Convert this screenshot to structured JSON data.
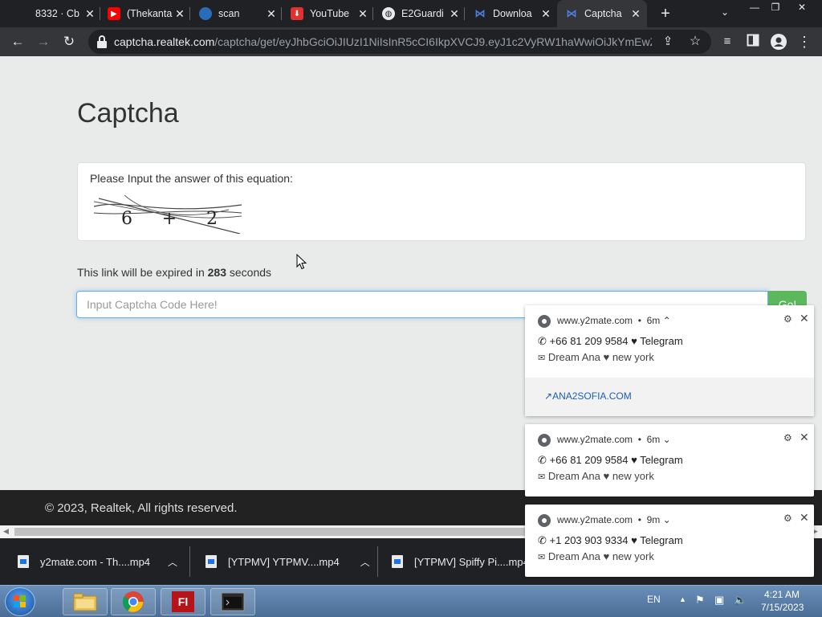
{
  "browser": {
    "tabs": [
      {
        "title": "8332 · Cb",
        "fav_color": "#202124",
        "icon": "generic-icon"
      },
      {
        "title": "(Thekanta",
        "fav_color": "#ff0000",
        "icon": "youtube-icon"
      },
      {
        "title": "scan",
        "fav_color": "#4a90d9",
        "icon": "scan-icon"
      },
      {
        "title": "YouTube",
        "fav_color": "#e0312f",
        "icon": "download-icon"
      },
      {
        "title": "E2Guardi",
        "fav_color": "#e8eaed",
        "icon": "globe-icon"
      },
      {
        "title": "Downloa",
        "fav_color": "#4a7fd9",
        "icon": "download-site-icon"
      },
      {
        "title": "Captcha",
        "fav_color": "#4a7fd9",
        "icon": "captcha-site-icon"
      }
    ],
    "tab_close": "✕",
    "new_tab": "+",
    "tab_menu": "⌄",
    "window_controls": {
      "minimize": "—",
      "restore": "❐",
      "close": "✕"
    },
    "url_host": "captcha.realtek.com",
    "url_path": "/captcha/get/eyJhbGciOiJIUzI1NiIsInR5cCI6IkpXVCJ9.eyJ1c2VyRW1haWwiOiJkYmEwZD..."
  },
  "page": {
    "title": "Captcha",
    "prompt": "Please Input the answer of this equation:",
    "captcha_text": "6 + 2",
    "expire_prefix": "This link will be expired in",
    "expire_seconds": "283",
    "expire_suffix": "seconds",
    "input_placeholder": "Input Captcha Code Here!",
    "go_label": "Go!"
  },
  "footer": {
    "text": "© 2023, Realtek, All rights reserved."
  },
  "downloads": [
    {
      "name": "y2mate.com - Th....mp4"
    },
    {
      "name": "[YTPMV] YTPMV....mp4"
    },
    {
      "name": "[YTPMV] Spiffy Pi....mp4"
    }
  ],
  "notifications": [
    {
      "source": "www.y2mate.com",
      "time": "6m",
      "chevron": "⌃",
      "line1": "+66 81 209 9584 ♥ Telegram",
      "line2": "Dream Ana ♥ new york",
      "action": "ANA2SOFIA.COM"
    },
    {
      "source": "www.y2mate.com",
      "time": "6m",
      "chevron": "⌄",
      "line1": "+66 81 209 9584 ♥ Telegram",
      "line2": "Dream Ana ♥ new york"
    },
    {
      "source": "www.y2mate.com",
      "time": "9m",
      "chevron": "⌄",
      "line1": "+1 203 903 9334 ♥ Telegram",
      "line2": "Dream Ana ♥ new york"
    }
  ],
  "taskbar": {
    "lang": "EN",
    "time": "4:21 AM",
    "date": "7/15/2023",
    "apps": [
      "explorer-icon",
      "chrome-icon",
      "flash-icon",
      "terminal-icon"
    ]
  }
}
